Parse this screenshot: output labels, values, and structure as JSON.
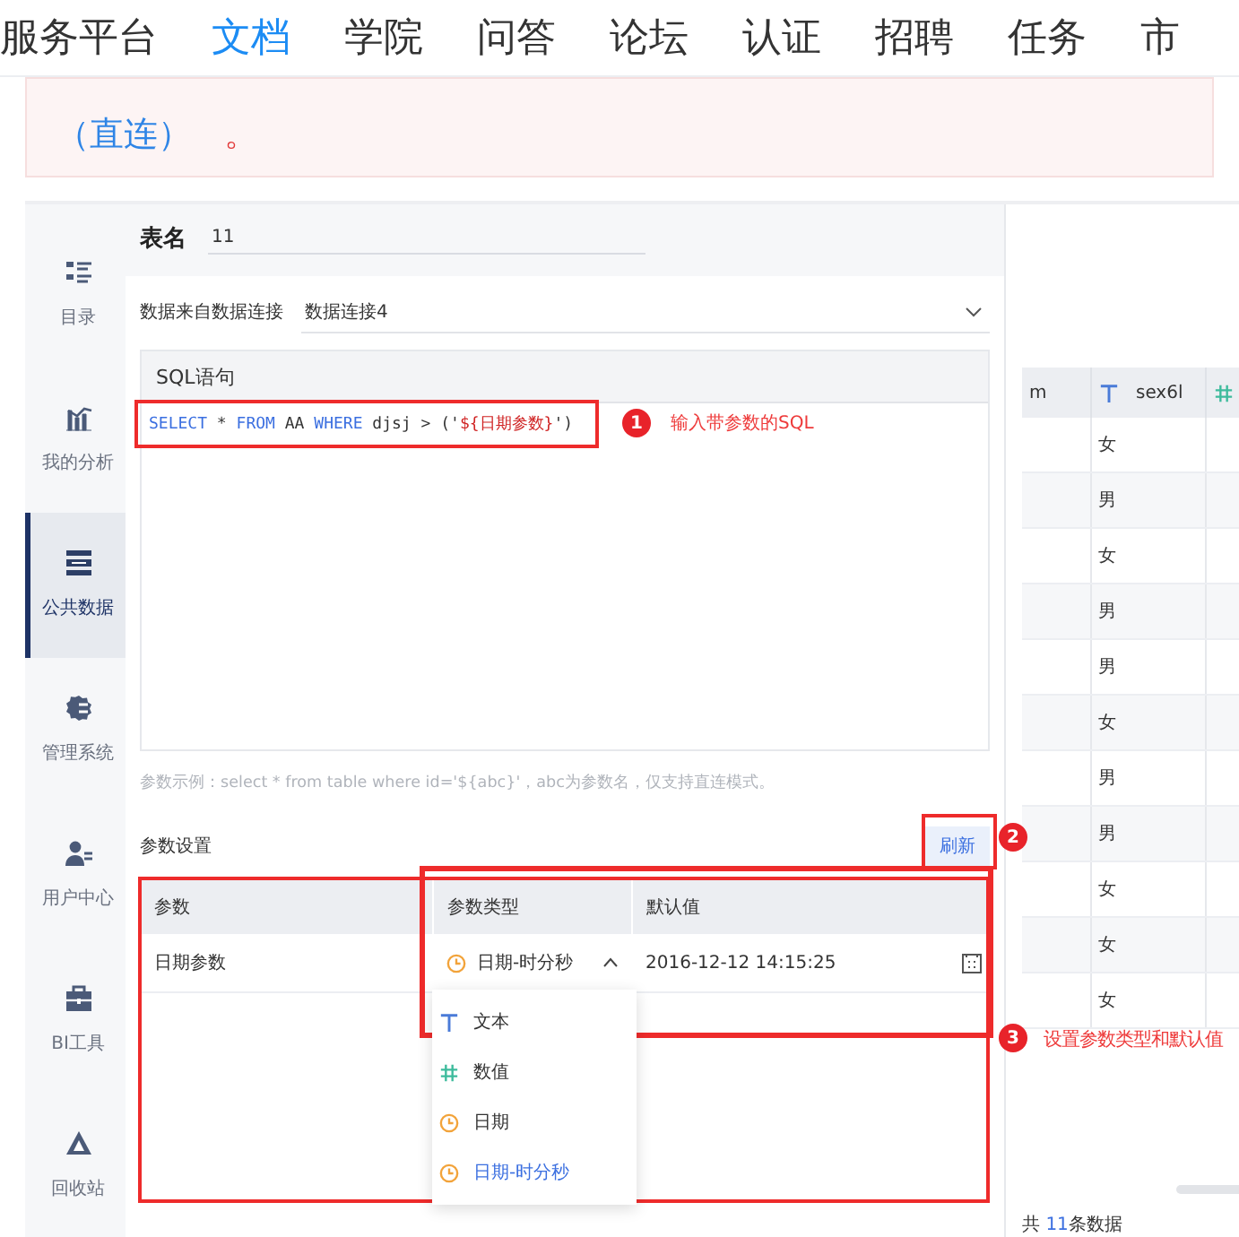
{
  "nav": {
    "items": [
      {
        "label": "服务平台",
        "selected": false
      },
      {
        "label": "文档",
        "selected": true
      },
      {
        "label": "学院",
        "selected": false
      },
      {
        "label": "问答",
        "selected": false
      },
      {
        "label": "论坛",
        "selected": false
      },
      {
        "label": "认证",
        "selected": false
      },
      {
        "label": "招聘",
        "selected": false
      },
      {
        "label": "任务",
        "selected": false
      },
      {
        "label": "市",
        "selected": false
      }
    ]
  },
  "notice": {
    "link": "（直连）",
    "tail": "。"
  },
  "sidebar": {
    "items": [
      {
        "label": "目录",
        "kind": "catalog",
        "selected": false
      },
      {
        "label": "我的分析",
        "kind": "analysis",
        "selected": false
      },
      {
        "label": "公共数据",
        "kind": "data",
        "selected": true
      },
      {
        "label": "管理系统",
        "kind": "system",
        "selected": false
      },
      {
        "label": "用户中心",
        "kind": "user",
        "selected": false
      },
      {
        "label": "BI工具",
        "kind": "tools",
        "selected": false
      },
      {
        "label": "回收站",
        "kind": "recycle",
        "selected": false
      }
    ]
  },
  "table_name": {
    "label": "表名",
    "value": "11"
  },
  "connection": {
    "label": "数据来自数据连接",
    "value": "数据连接4"
  },
  "sql": {
    "title": "SQL语句",
    "tokens": [
      {
        "text": "SELECT",
        "kind": "keyword"
      },
      {
        "text": " * ",
        "kind": "plain"
      },
      {
        "text": "FROM",
        "kind": "keyword"
      },
      {
        "text": " AA ",
        "kind": "plain"
      },
      {
        "text": "WHERE",
        "kind": "keyword"
      },
      {
        "text": " djsj > ('",
        "kind": "plain"
      },
      {
        "text": "${日期参数}",
        "kind": "param"
      },
      {
        "text": "')",
        "kind": "plain"
      }
    ]
  },
  "hint": "参数示例：select * from table where id='${abc}'，abc为参数名，仅支持直连模式。",
  "params": {
    "title": "参数设置",
    "refresh": "刷新",
    "columns": [
      "参数",
      "参数类型",
      "默认值"
    ],
    "rows": [
      {
        "name": "日期参数",
        "type": "日期-时分秒",
        "expanded": true,
        "default": "2016-12-12 14:15:25"
      }
    ],
    "options": [
      {
        "label": "文本",
        "kind": "text",
        "selected": false
      },
      {
        "label": "数值",
        "kind": "number",
        "selected": false
      },
      {
        "label": "日期",
        "kind": "date",
        "selected": false
      },
      {
        "label": "日期-时分秒",
        "kind": "date",
        "selected": true
      }
    ]
  },
  "preview": {
    "columns": [
      {
        "label": "m"
      },
      {
        "label": "sex6l",
        "kind": "text"
      },
      {
        "kind": "number"
      }
    ],
    "rows": [
      "女",
      "男",
      "女",
      "男",
      "男",
      "女",
      "男",
      "男",
      "女",
      "女",
      "女"
    ],
    "footer": {
      "prefix": "共",
      "count": "11",
      "suffix": "条数据"
    }
  },
  "annotations": [
    {
      "number": "1",
      "text": "输入带参数的SQL"
    },
    {
      "number": "2"
    },
    {
      "number": "3",
      "text": "设置参数类型和默认值"
    }
  ]
}
